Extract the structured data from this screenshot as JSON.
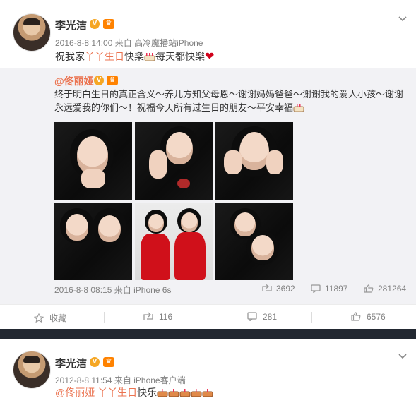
{
  "post1": {
    "username": "李光洁",
    "timestamp": "2016-8-8 14:00",
    "source_prefix": "来自",
    "source": "高冷魔播站iPhone",
    "text_before": "祝我家",
    "text_hl": "丫丫生日",
    "text_mid": "快樂",
    "text_after": "每天都快樂",
    "repost": {
      "username": "@佟丽娅",
      "text": "终于明白生日的真正含义～养儿方知父母恩～谢谢妈妈爸爸～谢谢我的爱人小孩～谢谢永远爱我的你们～！祝福今天所有过生日的朋友～平安幸福",
      "timestamp": "2016-8-8 08:15",
      "source_prefix": "来自",
      "source": "iPhone 6s",
      "reposts": "3692",
      "comments": "11897",
      "likes": "281264"
    },
    "actions": {
      "favorite": "收藏",
      "repost": "116",
      "comment": "281",
      "like": "6576"
    }
  },
  "post2": {
    "username": "李光洁",
    "timestamp": "2012-8-8 11:54",
    "source_prefix": "来自",
    "source": "iPhone客户端",
    "mention": "@佟丽娅",
    "text_hl": "丫丫生日",
    "text_after": "快乐"
  },
  "badges": {
    "verified": "V",
    "member": "♛"
  },
  "colors": {
    "accent": "#eb7350",
    "verified": "#f5a623",
    "member": "#ff8200",
    "heart": "#d0021b"
  },
  "icons": [
    "chevron-down-icon",
    "cake-emoji",
    "heart-emoji",
    "repost-icon",
    "comment-icon",
    "like-icon",
    "favorite-icon"
  ]
}
